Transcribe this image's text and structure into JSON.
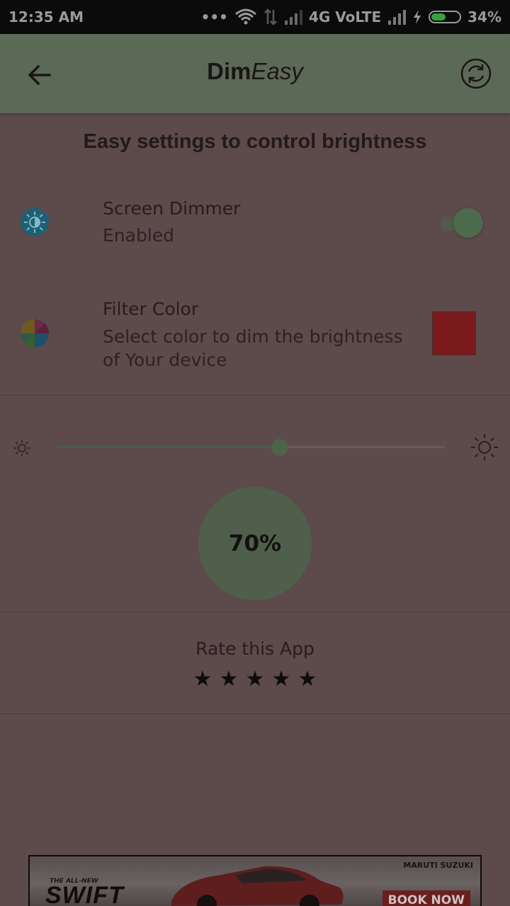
{
  "status_bar": {
    "time": "12:35 AM",
    "dots": "•••",
    "network": "4G VoLTE",
    "battery": "34%"
  },
  "app_bar": {
    "title_bold": "Dim",
    "title_italic": "Easy",
    "icons": {
      "back": "arrow-left-icon",
      "refresh": "refresh-icon"
    }
  },
  "headline": "Easy settings to control brightness",
  "screen_dimmer": {
    "title": "Screen Dimmer",
    "subtitle": "Enabled",
    "enabled": true,
    "icon": "brightness-icon"
  },
  "filter_color": {
    "title": "Filter Color",
    "subtitle": "Select color to dim the brightness of Your device",
    "color": "#7b1a1c",
    "icon": "color-wheel-icon"
  },
  "brightness": {
    "percent": 70,
    "label": "70%"
  },
  "rating": {
    "label": "Rate this App",
    "stars": [
      "★",
      "★",
      "★",
      "★",
      "★"
    ]
  },
  "ad": {
    "small_text": "THE ALL-NEW",
    "headline": "SWIFT",
    "maker": "MARUTI SUZUKI",
    "cta": "BOOK NOW"
  },
  "colors": {
    "app_bar": "#5b6a56",
    "background": "#5d4a4b",
    "accent": "#4c6448"
  }
}
